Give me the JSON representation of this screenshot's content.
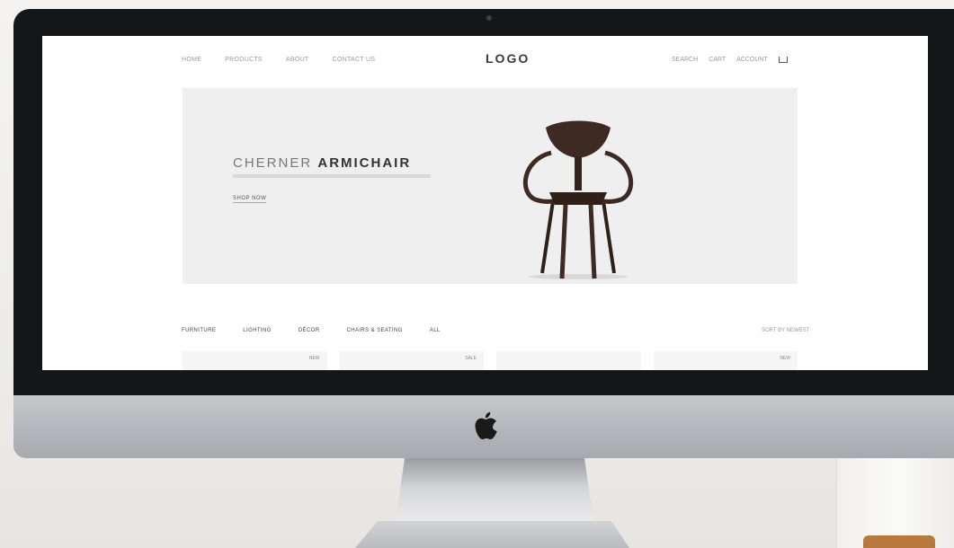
{
  "site": {
    "logo": "LOGO",
    "nav_left": [
      "HOME",
      "PRODUCTS",
      "ABOUT",
      "CONTACT US"
    ],
    "nav_right": [
      "SEARCH",
      "CART",
      "ACCOUNT"
    ]
  },
  "hero": {
    "title_light": "CHERNER",
    "title_bold": "ARMICHAIR",
    "cta_label": "SHOP NOW"
  },
  "filters": [
    "FURNITURE",
    "LIGHTING",
    "DÉCOR",
    "CHAIRS & SEATING",
    "ALL"
  ],
  "sort_label": "SORT BY NEWEST",
  "products": [
    {
      "tag": "NEW"
    },
    {
      "tag": "SALE"
    },
    {
      "tag": ""
    },
    {
      "tag": "NEW"
    }
  ],
  "colors": {
    "badge": "#c9553a",
    "bezel": "#151617",
    "chin": "#b4b6bb",
    "chair_wood": "#3d2a22"
  }
}
